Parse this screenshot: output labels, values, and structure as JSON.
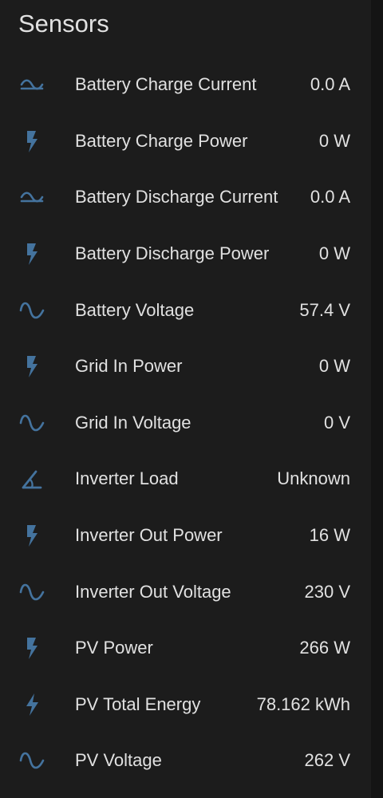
{
  "card": {
    "title": "Sensors",
    "icon_color": "#44739e"
  },
  "sensors": [
    {
      "label": "Battery Charge Current",
      "value": "0.0 A",
      "icon": "current-ac-icon"
    },
    {
      "label": "Battery Charge Power",
      "value": "0 W",
      "icon": "flash-icon"
    },
    {
      "label": "Battery Discharge Current",
      "value": "0.0 A",
      "icon": "current-ac-icon"
    },
    {
      "label": "Battery Discharge Power",
      "value": "0 W",
      "icon": "flash-icon"
    },
    {
      "label": "Battery Voltage",
      "value": "57.4 V",
      "icon": "sine-wave-icon"
    },
    {
      "label": "Grid In Power",
      "value": "0 W",
      "icon": "flash-icon"
    },
    {
      "label": "Grid In Voltage",
      "value": "0 V",
      "icon": "sine-wave-icon"
    },
    {
      "label": "Inverter Load",
      "value": "Unknown",
      "icon": "angle-acute-icon"
    },
    {
      "label": "Inverter Out Power",
      "value": "16 W",
      "icon": "flash-icon"
    },
    {
      "label": "Inverter Out Voltage",
      "value": "230 V",
      "icon": "sine-wave-icon"
    },
    {
      "label": "PV Power",
      "value": "266 W",
      "icon": "flash-icon"
    },
    {
      "label": "PV Total Energy",
      "value": "78.162 kWh",
      "icon": "lightning-bolt-icon"
    },
    {
      "label": "PV Voltage",
      "value": "262 V",
      "icon": "sine-wave-icon"
    }
  ]
}
